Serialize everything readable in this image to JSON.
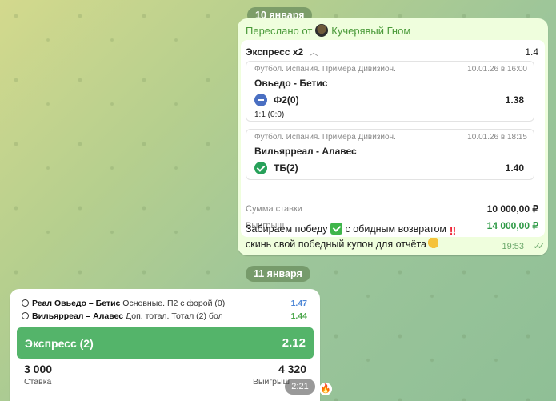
{
  "date_1": "10 января",
  "date_2": "11 января",
  "message1": {
    "forwarded_prefix": "Переслано от",
    "forwarded_name": "Кучерявый Гном",
    "bet_title": "Экспресс х2",
    "bet_total_coef": "1.4",
    "events": [
      {
        "league": "Футбол. Испания. Примера Дивизион.",
        "datetime": "10.01.26 в 16:00",
        "teams": "Овьедо - Бетис",
        "bet": "Ф2(0)",
        "coef": "1.38",
        "score": "1:1 (0:0)",
        "status_icon": "minus-icon"
      },
      {
        "league": "Футбол. Испания. Примера Дивизион.",
        "datetime": "10.01.26 в 18:15",
        "teams": "Вильярреал - Алавес",
        "bet": "ТБ(2)",
        "coef": "1.40",
        "status_icon": "check-icon"
      }
    ],
    "stake_label": "Сумма ставки",
    "stake_value": "10 000,00 ₽",
    "win_label": "Выигрыш",
    "win_value": "14 000,00 ₽",
    "text_line1_a": "Забираем победу",
    "text_line1_b": "с обидным возвратом",
    "text_line2": "скинь свой победный купон для отчёта",
    "time": "19:53",
    "accent_color": "#4a9a3a"
  },
  "message2": {
    "rows": [
      {
        "teams": "Реал Овьедо – Бетис",
        "market": "Основные. П2 с форой (0)",
        "coef": "1.47"
      },
      {
        "teams": "Вильярреал – Алавес",
        "market": "Доп. тотал. Тотал (2) бол",
        "coef": "1.44"
      }
    ],
    "express_label": "Экспресс (2)",
    "express_coef": "2.12",
    "stake_value": "3 000",
    "stake_label": "Ставка",
    "win_value": "4 320",
    "win_label": "Выигрыш",
    "time": "2:21",
    "bar_color": "#54b46a"
  }
}
